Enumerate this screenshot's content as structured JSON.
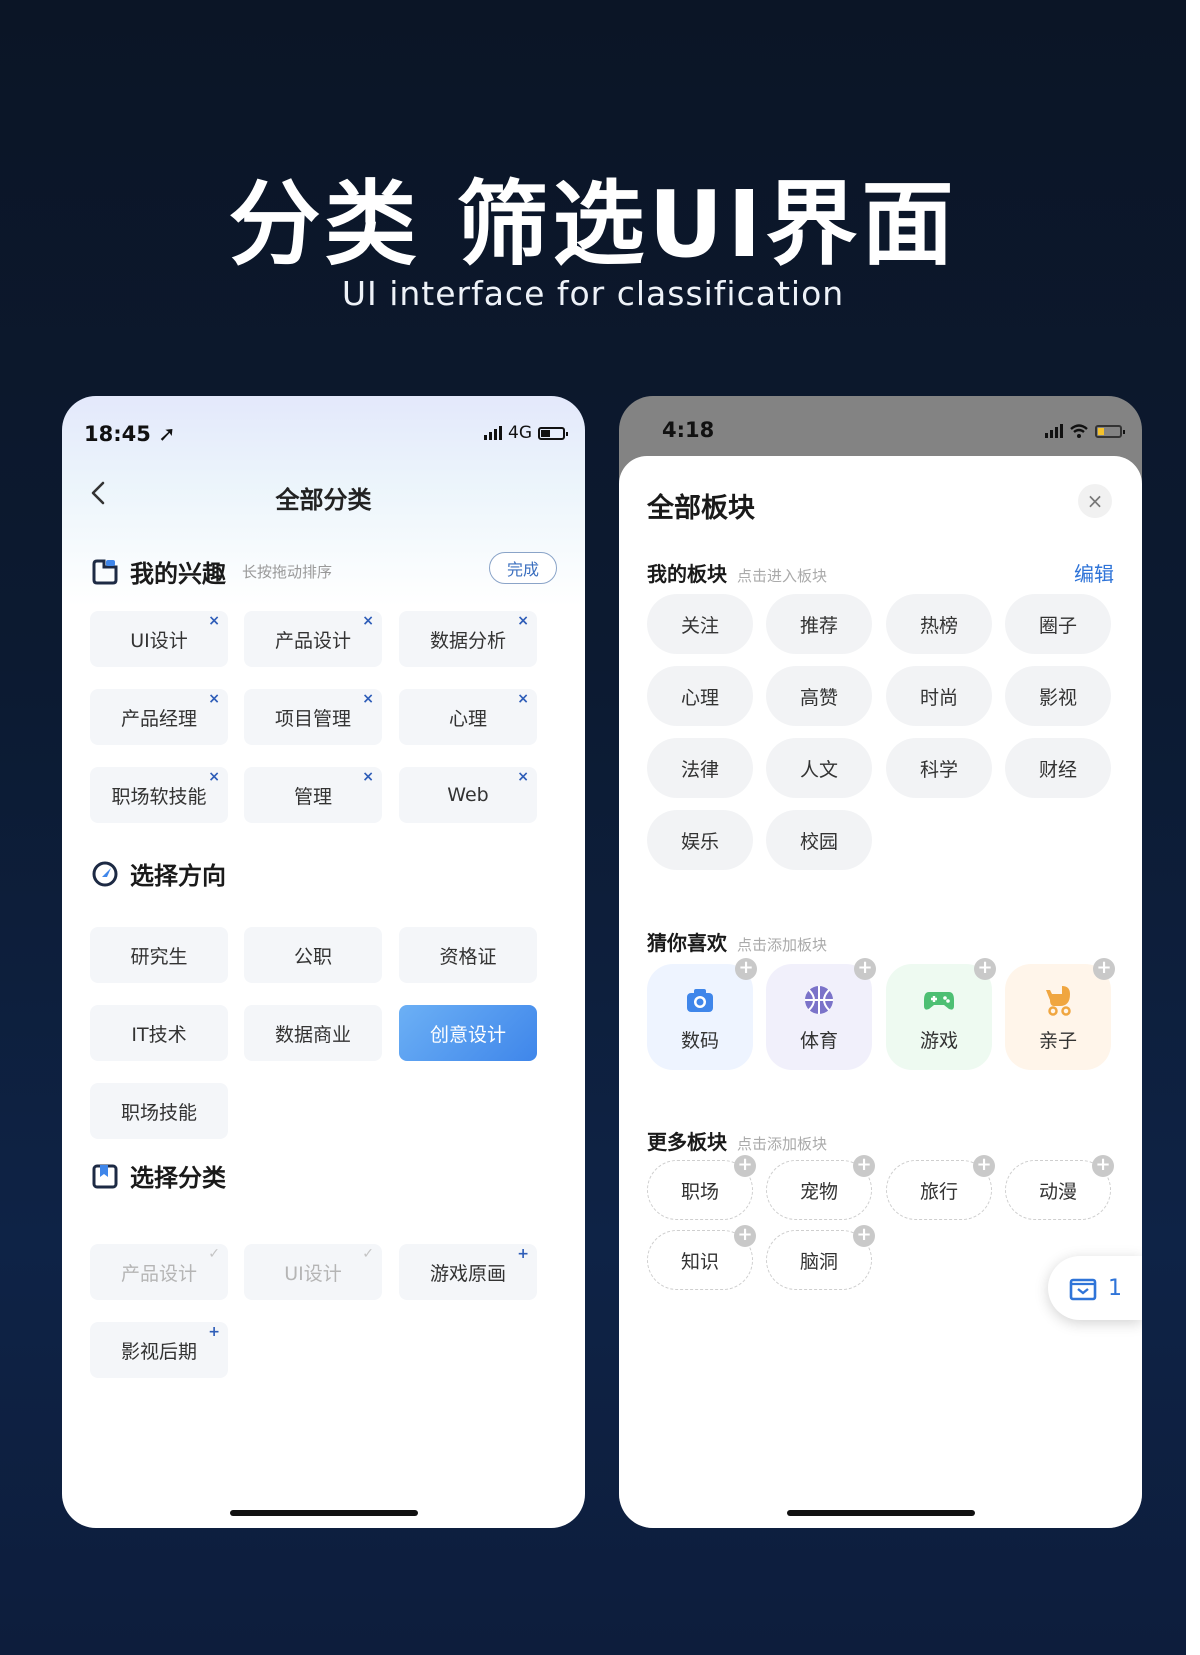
{
  "header": {
    "title": "分类 筛选UI界面",
    "subtitle": "UI interface for classification"
  },
  "phone_left": {
    "status": {
      "time": "18:45",
      "network": "4G"
    },
    "nav_title": "全部分类",
    "interests": {
      "title": "我的兴趣",
      "hint": "长按拖动排序",
      "done_label": "完成",
      "tags": [
        "UI设计",
        "产品设计",
        "数据分析",
        "产品经理",
        "项目管理",
        "心理",
        "职场软技能",
        "管理",
        "Web"
      ]
    },
    "direction": {
      "title": "选择方向",
      "tags": [
        "研究生",
        "公职",
        "资格证",
        "IT技术",
        "数据商业",
        "创意设计",
        "职场技能"
      ],
      "selected": "创意设计"
    },
    "category": {
      "title": "选择分类",
      "tags": [
        {
          "label": "产品设计",
          "state": "added"
        },
        {
          "label": "UI设计",
          "state": "added"
        },
        {
          "label": "游戏原画",
          "state": "add"
        },
        {
          "label": "影视后期",
          "state": "add"
        }
      ]
    }
  },
  "phone_right": {
    "status": {
      "time": "4:18"
    },
    "sheet_title": "全部板块",
    "close_label": "×",
    "my_boards": {
      "title": "我的板块",
      "hint": "点击进入板块",
      "edit_label": "编辑",
      "items": [
        "关注",
        "推荐",
        "热榜",
        "圈子",
        "心理",
        "高赞",
        "时尚",
        "影视",
        "法律",
        "人文",
        "科学",
        "财经",
        "娱乐",
        "校园"
      ]
    },
    "guess": {
      "title": "猜你喜欢",
      "hint": "点击添加板块",
      "items": [
        {
          "label": "数码",
          "icon": "camera-icon",
          "bg": "#eef4ff",
          "color": "#3f86ea"
        },
        {
          "label": "体育",
          "icon": "basketball-icon",
          "bg": "#f1f0fb",
          "color": "#7b73c9"
        },
        {
          "label": "游戏",
          "icon": "gamepad-icon",
          "bg": "#eefaf1",
          "color": "#4dbf73"
        },
        {
          "label": "亲子",
          "icon": "stroller-icon",
          "bg": "#fff5ea",
          "color": "#f0a640"
        }
      ]
    },
    "more": {
      "title": "更多板块",
      "hint": "点击添加板块",
      "items": [
        "职场",
        "宠物",
        "旅行",
        "动漫",
        "知识",
        "脑洞"
      ]
    },
    "float_count": "1"
  }
}
